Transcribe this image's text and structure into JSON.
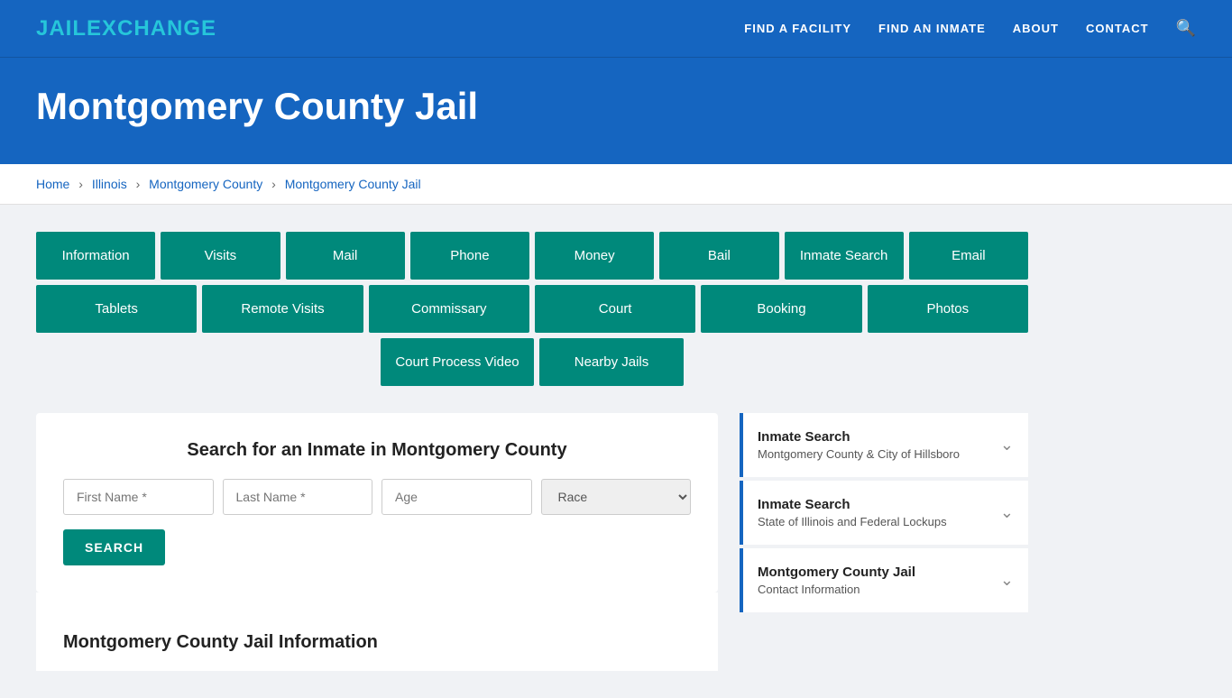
{
  "header": {
    "logo_jail": "JAIL",
    "logo_exchange": "EXCHANGE",
    "nav": [
      {
        "label": "FIND A FACILITY",
        "href": "#"
      },
      {
        "label": "FIND AN INMATE",
        "href": "#"
      },
      {
        "label": "ABOUT",
        "href": "#"
      },
      {
        "label": "CONTACT",
        "href": "#"
      }
    ]
  },
  "hero": {
    "title": "Montgomery County Jail"
  },
  "breadcrumb": {
    "items": [
      {
        "label": "Home",
        "href": "#"
      },
      {
        "label": "Illinois",
        "href": "#"
      },
      {
        "label": "Montgomery County",
        "href": "#"
      },
      {
        "label": "Montgomery County Jail",
        "href": "#",
        "current": true
      }
    ]
  },
  "buttons_row1": [
    {
      "label": "Information"
    },
    {
      "label": "Visits"
    },
    {
      "label": "Mail"
    },
    {
      "label": "Phone"
    },
    {
      "label": "Money"
    },
    {
      "label": "Bail"
    },
    {
      "label": "Inmate Search"
    }
  ],
  "buttons_row2": [
    {
      "label": "Email"
    },
    {
      "label": "Tablets"
    },
    {
      "label": "Remote Visits"
    },
    {
      "label": "Commissary"
    },
    {
      "label": "Court"
    },
    {
      "label": "Booking"
    },
    {
      "label": "Photos"
    }
  ],
  "buttons_row3": [
    {
      "label": "Court Process Video"
    },
    {
      "label": "Nearby Jails"
    }
  ],
  "search": {
    "title": "Search for an Inmate in Montgomery County",
    "first_name_placeholder": "First Name *",
    "last_name_placeholder": "Last Name *",
    "age_placeholder": "Age",
    "race_placeholder": "Race",
    "button_label": "SEARCH"
  },
  "info_heading": "Montgomery County Jail Information",
  "sidebar": {
    "items": [
      {
        "title": "Inmate Search",
        "subtitle": "Montgomery County & City of Hillsboro"
      },
      {
        "title": "Inmate Search",
        "subtitle": "State of Illinois and Federal Lockups"
      },
      {
        "title": "Montgomery County Jail",
        "subtitle": "Contact Information"
      }
    ]
  }
}
